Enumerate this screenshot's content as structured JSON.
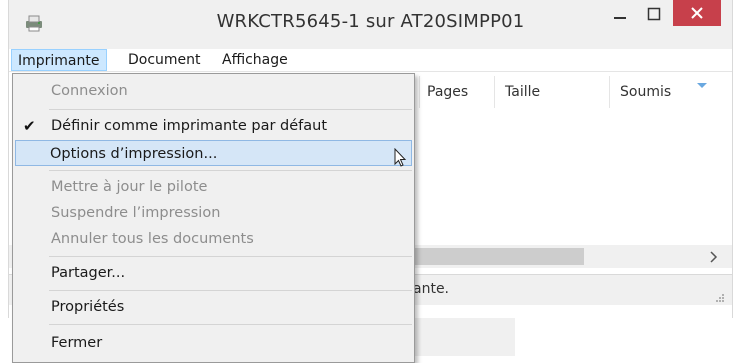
{
  "window": {
    "title": "WRKCTR5645-1 sur AT20SIMPP01",
    "close_color": "#c7404b",
    "app_icon": "printer-icon"
  },
  "menubar": {
    "items": [
      {
        "label": "Imprimante",
        "active": true
      },
      {
        "label": "Document"
      },
      {
        "label": "Affichage"
      }
    ]
  },
  "columns": [
    "Pages",
    "Taille",
    "Soumis"
  ],
  "status_text": "ante.",
  "dropdown": {
    "items": [
      {
        "label": "Connexion",
        "disabled": true
      },
      {
        "label": "Définir comme imprimante par défaut",
        "checked": true
      },
      {
        "label": "Options d’impression...",
        "hover": true
      },
      {
        "label": "Mettre à jour le pilote",
        "disabled": true
      },
      {
        "label": "Suspendre l’impression",
        "disabled": true
      },
      {
        "label": "Annuler tous les documents",
        "disabled": true
      },
      {
        "label": "Partager..."
      },
      {
        "label": "Propriétés"
      },
      {
        "label": "Fermer"
      }
    ]
  }
}
